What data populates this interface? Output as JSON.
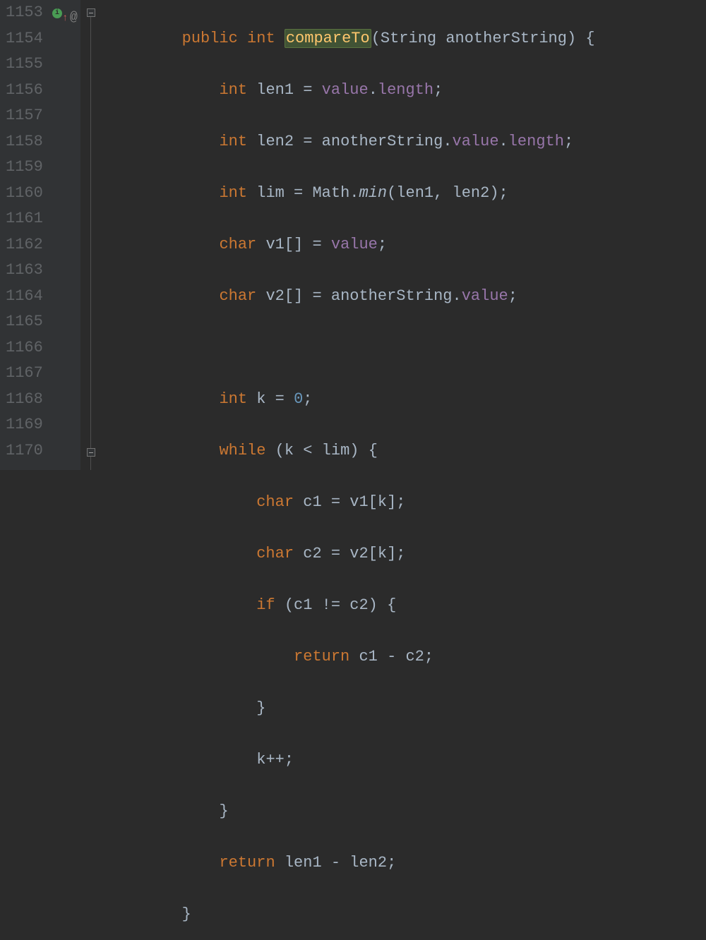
{
  "line_numbers": [
    "1153",
    "1154",
    "1155",
    "1156",
    "1157",
    "1158",
    "1159",
    "1160",
    "1161",
    "1162",
    "1163",
    "1164",
    "1165",
    "1166",
    "1167",
    "1168",
    "1169",
    "1170"
  ],
  "gutter_icons": {
    "override": "i",
    "up_arrow": "↑",
    "at": "@"
  },
  "code": {
    "l0": {
      "indent": "        ",
      "kw1": "public",
      "sp1": " ",
      "kw2": "int",
      "sp2": " ",
      "method": "compareTo",
      "paren1": "(",
      "type": "String",
      "sp3": " ",
      "param": "anotherString",
      "paren2": ")",
      "sp4": " ",
      "brace": "{"
    },
    "l1": {
      "indent": "            ",
      "kw": "int",
      "sp": " ",
      "var": "len1",
      "op": " = ",
      "field": "value",
      "dot": ".",
      "prop": "length",
      "semi": ";"
    },
    "l2": {
      "indent": "            ",
      "kw": "int",
      "sp": " ",
      "var": "len2",
      "op": " = ",
      "param": "anotherString",
      "dot1": ".",
      "field": "value",
      "dot2": ".",
      "prop": "length",
      "semi": ";"
    },
    "l3": {
      "indent": "            ",
      "kw": "int",
      "sp": " ",
      "var": "lim",
      "op": " = ",
      "cls": "Math",
      "dot": ".",
      "method": "min",
      "paren1": "(",
      "arg1": "len1",
      "comma": ", ",
      "arg2": "len2",
      "paren2": ")",
      "semi": ";"
    },
    "l4": {
      "indent": "            ",
      "kw": "char",
      "sp": " ",
      "var": "v1",
      "brackets": "[]",
      "op": " = ",
      "field": "value",
      "semi": ";"
    },
    "l5": {
      "indent": "            ",
      "kw": "char",
      "sp": " ",
      "var": "v2",
      "brackets": "[]",
      "op": " = ",
      "param": "anotherString",
      "dot": ".",
      "field": "value",
      "semi": ";"
    },
    "l6": {
      "indent": ""
    },
    "l7": {
      "indent": "            ",
      "kw": "int",
      "sp": " ",
      "var": "k",
      "op": " = ",
      "num": "0",
      "semi": ";"
    },
    "l8": {
      "indent": "            ",
      "kw": "while",
      "sp": " ",
      "paren1": "(",
      "var1": "k",
      "op": " < ",
      "var2": "lim",
      "paren2": ")",
      "sp2": " ",
      "brace": "{"
    },
    "l9": {
      "indent": "                ",
      "kw": "char",
      "sp": " ",
      "var": "c1",
      "op": " = ",
      "arr": "v1",
      "bracket1": "[",
      "idx": "k",
      "bracket2": "]",
      "semi": ";"
    },
    "l10": {
      "indent": "                ",
      "kw": "char",
      "sp": " ",
      "var": "c2",
      "op": " = ",
      "arr": "v2",
      "bracket1": "[",
      "idx": "k",
      "bracket2": "]",
      "semi": ";"
    },
    "l11": {
      "indent": "                ",
      "kw": "if",
      "sp": " ",
      "paren1": "(",
      "var1": "c1",
      "op": " != ",
      "var2": "c2",
      "paren2": ")",
      "sp2": " ",
      "brace": "{"
    },
    "l12": {
      "indent": "                    ",
      "kw": "return",
      "sp": " ",
      "var1": "c1",
      "op": " - ",
      "var2": "c2",
      "semi": ";"
    },
    "l13": {
      "indent": "                ",
      "brace": "}"
    },
    "l14": {
      "indent": "                ",
      "var": "k",
      "op": "++",
      "semi": ";"
    },
    "l15": {
      "indent": "            ",
      "brace": "}"
    },
    "l16": {
      "indent": "            ",
      "kw": "return",
      "sp": " ",
      "var1": "len1",
      "op": " - ",
      "var2": "len2",
      "semi": ";"
    },
    "l17": {
      "indent": "        ",
      "brace": "}"
    }
  }
}
